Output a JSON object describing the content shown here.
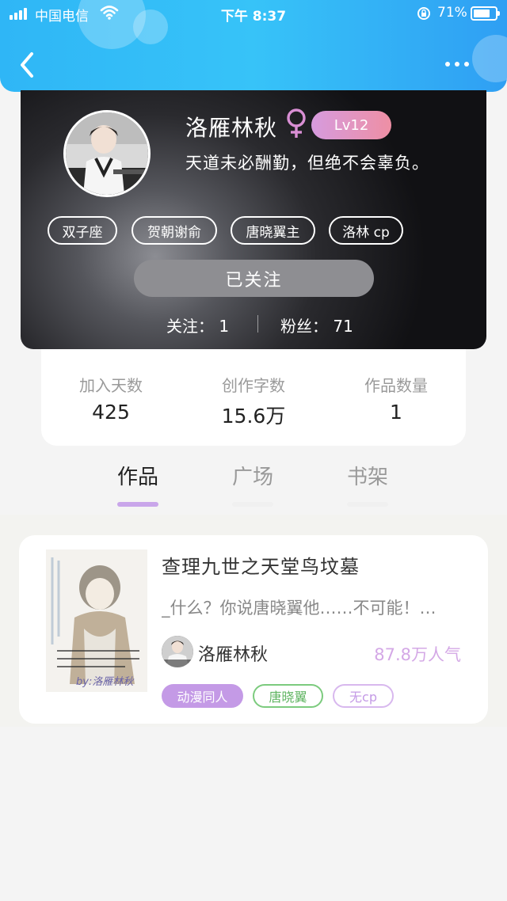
{
  "status_bar": {
    "carrier": "中国电信",
    "time": "下午 8:37",
    "battery": "71%"
  },
  "colors": {
    "header_gradient": [
      "#2fb6f6",
      "#2f9ff3"
    ],
    "level_badge": [
      "#d69bde",
      "#ee8fa4"
    ],
    "tab_active_underline": "#c9a6ea",
    "popularity_text": "#d4a8e6",
    "chip_primary": "#c49ae6",
    "chip_green": "#7ccb7e",
    "chip_lavender": "#d8b8ee"
  },
  "header": {
    "back_icon": "chevron-left-icon",
    "more_icon": "more-dots-icon"
  },
  "profile": {
    "username": "洛雁林秋",
    "gender_icon": "female-icon",
    "level": "Lv12",
    "bio": "天道未必酬勤，但绝不会辜负。",
    "tags": [
      "双子座",
      "贺朝谢俞",
      "唐晓翼主",
      "洛林 cp"
    ],
    "follow_button": "已关注",
    "following_label": "关注：",
    "following_count": "1",
    "followers_label": "粉丝：",
    "followers_count": "71"
  },
  "stats": [
    {
      "label": "加入天数",
      "value": "425"
    },
    {
      "label": "创作字数",
      "value": "15.6万"
    },
    {
      "label": "作品数量",
      "value": "1"
    }
  ],
  "tabs": [
    {
      "label": "作品",
      "active": true
    },
    {
      "label": "广场",
      "active": false
    },
    {
      "label": "书架",
      "active": false
    }
  ],
  "works": [
    {
      "title": "查理九世之天堂鸟坟墓",
      "excerpt": "_什么？你说唐晓翼他……不可能！…",
      "author": "洛雁林秋",
      "popularity": "87.8万人气",
      "chips": [
        "动漫同人",
        "唐晓翼",
        "无cp"
      ],
      "cover_watermark": "by:洛雁林秋"
    }
  ]
}
